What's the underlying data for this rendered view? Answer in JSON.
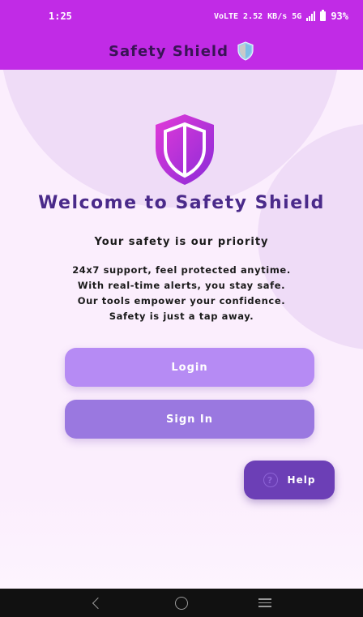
{
  "status_bar": {
    "time": "1:25",
    "network_indicators": "VoLTE 2.52 KB/s 5G",
    "battery": "93%"
  },
  "app_bar": {
    "title": "Safety Shield",
    "icon": "shield-icon"
  },
  "main": {
    "logo_icon": "shield-logo-icon",
    "welcome_title": "Welcome to Safety Shield",
    "priority_text": "Your safety is our priority",
    "tagline_lines": [
      "24x7 support, feel protected anytime.",
      "With real-time alerts, you stay safe.",
      "Our tools empower your confidence.",
      "Safety is just a tap away."
    ],
    "buttons": {
      "login_label": "Login",
      "signin_label": "Sign In",
      "help_label": "Help"
    }
  },
  "nav_bar": {
    "back_icon": "back-chevron-icon",
    "home_icon": "home-circle-icon",
    "recents_icon": "recents-menu-icon"
  },
  "colors": {
    "top_band": "#c12be6",
    "content_bg": "#fbeefd",
    "login_button": "#b68bf4",
    "signin_button": "#9a78e0",
    "help_button": "#6c3fb6",
    "title_text": "#4a2a8a"
  }
}
